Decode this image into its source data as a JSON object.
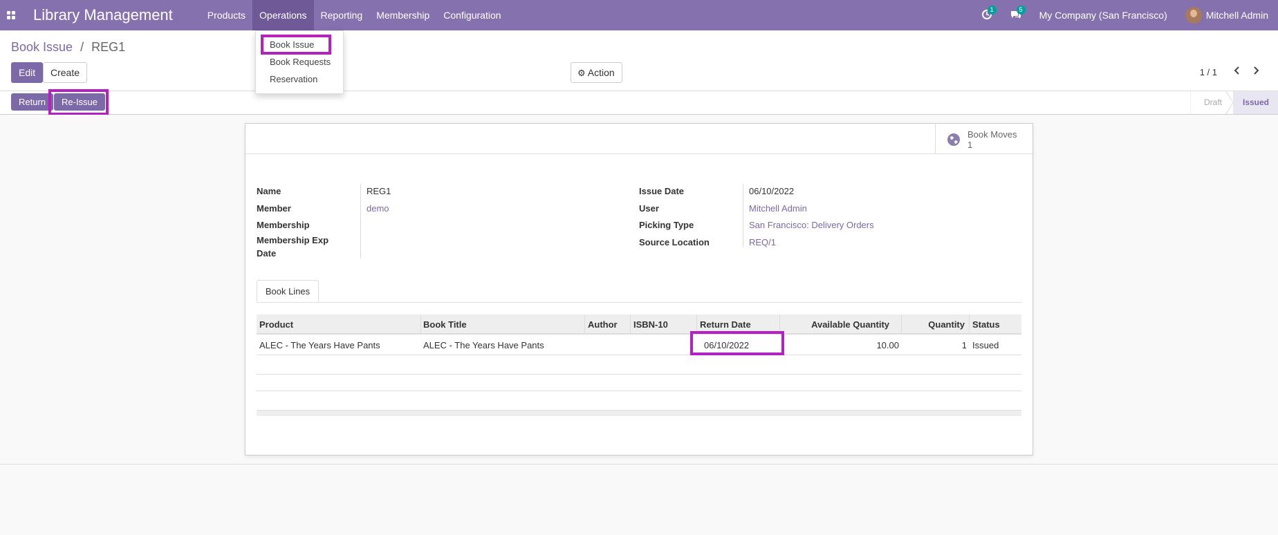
{
  "navbar": {
    "app_title": "Library Management",
    "menu": [
      {
        "label": "Products"
      },
      {
        "label": "Operations"
      },
      {
        "label": "Reporting"
      },
      {
        "label": "Membership"
      },
      {
        "label": "Configuration"
      }
    ],
    "activity_count": "1",
    "message_count": "5",
    "company": "My Company (San Francisco)",
    "user": "Mitchell Admin"
  },
  "dropdown": {
    "items": [
      "Book Issue",
      "Book Requests",
      "Reservation"
    ]
  },
  "breadcrumb": {
    "parent": "Book Issue",
    "separator": "/",
    "current": "REG1"
  },
  "control": {
    "edit_label": "Edit",
    "create_label": "Create",
    "action_label": "Action",
    "pager": "1 / 1"
  },
  "statusbar": {
    "return_label": "Return",
    "reissue_label": "Re-Issue",
    "stages": [
      "Draft",
      "Issued"
    ],
    "active_stage": "Issued"
  },
  "form": {
    "smart_button": {
      "label": "Book Moves",
      "count": "1"
    },
    "left_fields": [
      {
        "label": "Name",
        "value": "REG1"
      },
      {
        "label": "Member",
        "value": "demo"
      },
      {
        "label": "Membership",
        "value": ""
      },
      {
        "label": "Membership Exp Date",
        "value": ""
      }
    ],
    "right_fields": [
      {
        "label": "Issue Date",
        "value": "06/10/2022"
      },
      {
        "label": "User",
        "value": "Mitchell Admin"
      },
      {
        "label": "Picking Type",
        "value": "San Francisco: Delivery Orders"
      },
      {
        "label": "Source Location",
        "value": "REQ/1"
      }
    ],
    "tab_label": "Book Lines",
    "table": {
      "columns": [
        "Product",
        "Book Title",
        "Author",
        "ISBN-10",
        "Return Date",
        "Available Quantity",
        "Quantity",
        "Status"
      ],
      "rows": [
        [
          "ALEC - The Years Have Pants",
          "ALEC - The Years Have Pants",
          "",
          "",
          "06/10/2022",
          "10.00",
          "1",
          "Issued"
        ]
      ]
    }
  },
  "colors": {
    "brand": "#8571ae",
    "link": "#7c69a8",
    "highlight": "#b520c0"
  }
}
